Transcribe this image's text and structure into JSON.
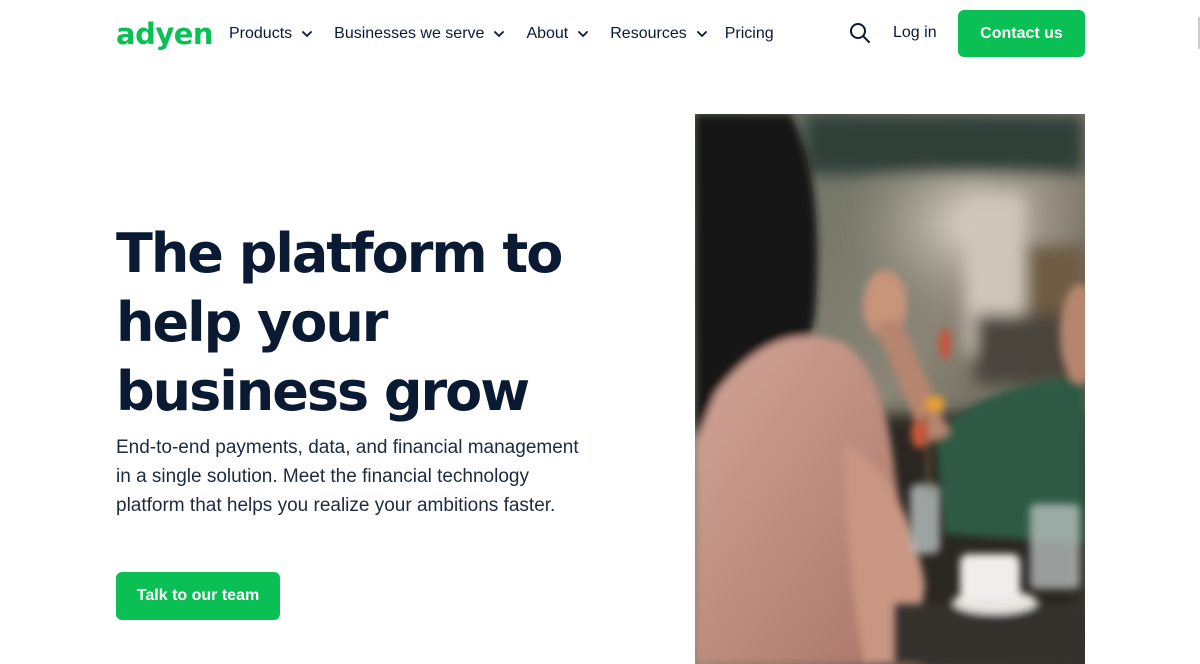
{
  "header": {
    "logo_text": "adyen",
    "nav": [
      {
        "label": "Products",
        "has_dropdown": true
      },
      {
        "label": "Businesses we serve",
        "has_dropdown": true
      },
      {
        "label": "About",
        "has_dropdown": true
      },
      {
        "label": "Resources",
        "has_dropdown": true
      },
      {
        "label": "Pricing",
        "has_dropdown": false
      }
    ],
    "search_icon": "search-icon",
    "login_label": "Log in",
    "contact_label": "Contact us"
  },
  "hero": {
    "title": "The platform to help your business grow",
    "description": "End-to-end payments, data, and financial management in a single solution. Meet the financial technology platform that helps you realize your ambitions faster.",
    "cta_label": "Talk to our team"
  },
  "colors": {
    "brand_green": "#0abf53",
    "text_dark": "#0b1a33",
    "background": "#ffffff"
  }
}
